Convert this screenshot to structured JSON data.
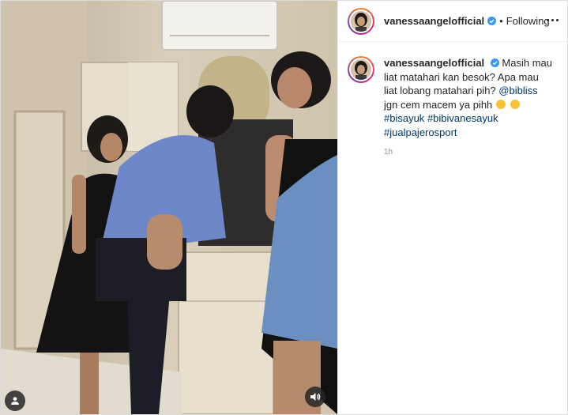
{
  "header": {
    "username": "vanessaangelofficial",
    "separator": "•",
    "follow_status": "Following",
    "more_icon": "more-horizontal-icon"
  },
  "caption": {
    "username": "vanessaangelofficial",
    "text_start": "Masih mau liat matahari kan besok? Apa mau liat lobang matahari pih?",
    "mention": "@bibliss",
    "text_mid": "jgn cem macem ya pihh",
    "hashtags": [
      "#bisayuk",
      "#bibivanesayuk",
      "#jualpajerosport"
    ],
    "time": "1h"
  },
  "video": {
    "user_tag_icon": "user-tag-icon",
    "audio_icon": "speaker-icon"
  },
  "colors": {
    "link": "#00376b",
    "verified": "#3897f0",
    "text": "#262626",
    "muted": "#8e8e8e"
  }
}
